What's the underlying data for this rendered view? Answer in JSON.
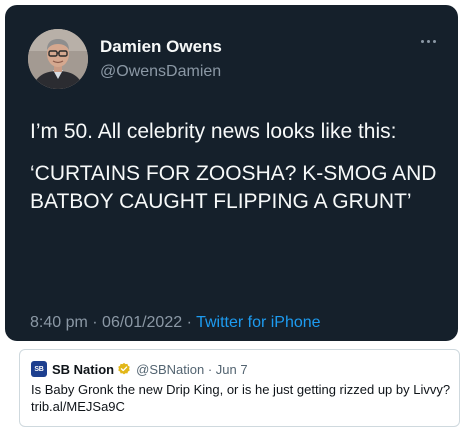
{
  "tweet": {
    "display_name": "Damien Owens",
    "handle": "@OwensDamien",
    "text_line1": "I’m 50. All celebrity news looks like this:",
    "text_quote": "‘CURTAINS FOR ZOOSHA? K-SMOG AND BATBOY CAUGHT FLIPPING A GRUNT’",
    "time": "8:40 pm",
    "date": "06/01/2022",
    "separator": "·",
    "source": "Twitter for iPhone",
    "more_icon": "more-horizontal-icon"
  },
  "embedded": {
    "logo_text": "SB",
    "name": "SB Nation",
    "verified_icon": "verified-badge-icon",
    "handle_date": "@SBNation · Jun 7",
    "text_line1": "Is Baby Gronk the new Drip King, or is he just getting rizzed up by Livvy?",
    "link": "trib.al/MEJSa9C"
  },
  "colors": {
    "dark_bg": "#15202b",
    "primary_text_dark": "#f7f9f9",
    "secondary_text_dark": "#8b98a5",
    "link_blue": "#1d9bf0",
    "sb_logo_bg": "#1d3f8f",
    "verified_gold": "#e2b719"
  }
}
